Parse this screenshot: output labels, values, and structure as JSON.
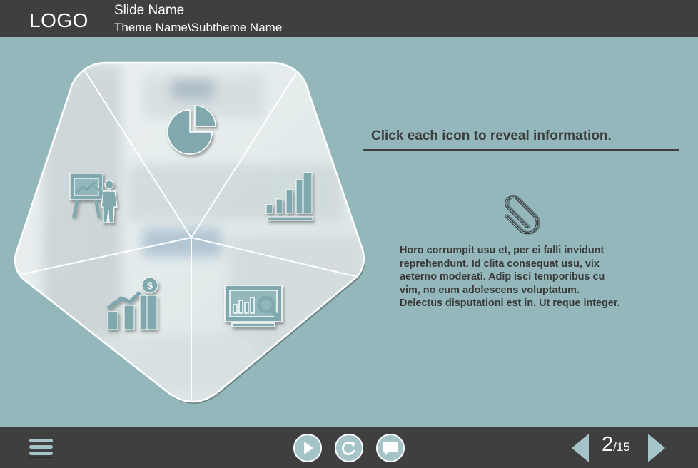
{
  "header": {
    "logo": "LOGO",
    "slide_name": "Slide Name",
    "theme_name": "Theme Name\\Subtheme Name"
  },
  "content": {
    "instruction": "Click each icon to reveal information.",
    "body_lines": [
      "Horo corrumpit usu et, per ei falli invidunt",
      "reprehendunt. Id clita consequat usu, vix",
      "aeterno moderati. Adip isci temporibus cu",
      "vim, no eum adolescens voluptatum.",
      "Delectus disputationi est in. Ut reque integer."
    ],
    "body_icon": "paperclip-icon"
  },
  "segments": [
    {
      "icon": "pie-chart-icon"
    },
    {
      "icon": "bar-chart-icon"
    },
    {
      "icon": "monitor-analytics-icon"
    },
    {
      "icon": "growth-money-icon"
    },
    {
      "icon": "presentation-icon"
    }
  ],
  "footer": {
    "current_page": "2",
    "total_pages": "/15",
    "controls": [
      "play-icon",
      "replay-icon",
      "comment-icon"
    ]
  },
  "colors": {
    "bar": "#3f3f3f",
    "background": "#93b7bb",
    "icon_fill": "#7fa9af",
    "button_fill": "#a4c4c8",
    "text": "#3a3a3a"
  }
}
